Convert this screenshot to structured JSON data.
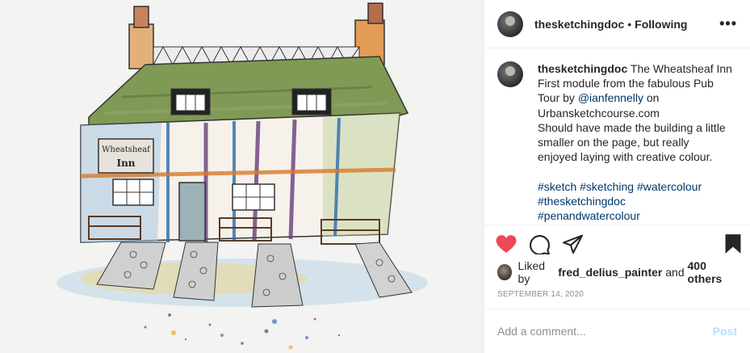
{
  "post": {
    "username": "thesketchingdoc",
    "separator": "•",
    "follow_state": "Following",
    "more_glyph": "•••"
  },
  "caption": {
    "username": "thesketchingdoc",
    "lines": [
      "The Wheatsheaf Inn",
      "First module from the fabulous Pub",
      "Tour by",
      "@ianfennelly",
      "on",
      "Urbansketchcourse.com",
      "Should have made the building a little",
      "smaller on the page, but really",
      "enjoyed laying with creative colour."
    ],
    "hashtags_line1": "#sketch #sketching #watercolour",
    "hashtags_line2": "#thesketchingdoc",
    "hashtags_line3": "#penandwatercolour"
  },
  "artwork": {
    "sign_line1": "Wheatsheaf",
    "sign_line2": "Inn"
  },
  "actions": {
    "like_icon": "heart-filled-icon",
    "comment_icon": "comment-icon",
    "share_icon": "send-icon",
    "save_icon": "bookmark-filled-icon",
    "like_color": "#ed4956"
  },
  "likes": {
    "prefix": "Liked by",
    "user": "fred_delius_painter",
    "connector": "and",
    "count": "400 others"
  },
  "date": "September 14, 2020",
  "comment": {
    "placeholder": "Add a comment...",
    "post_label": "Post"
  }
}
